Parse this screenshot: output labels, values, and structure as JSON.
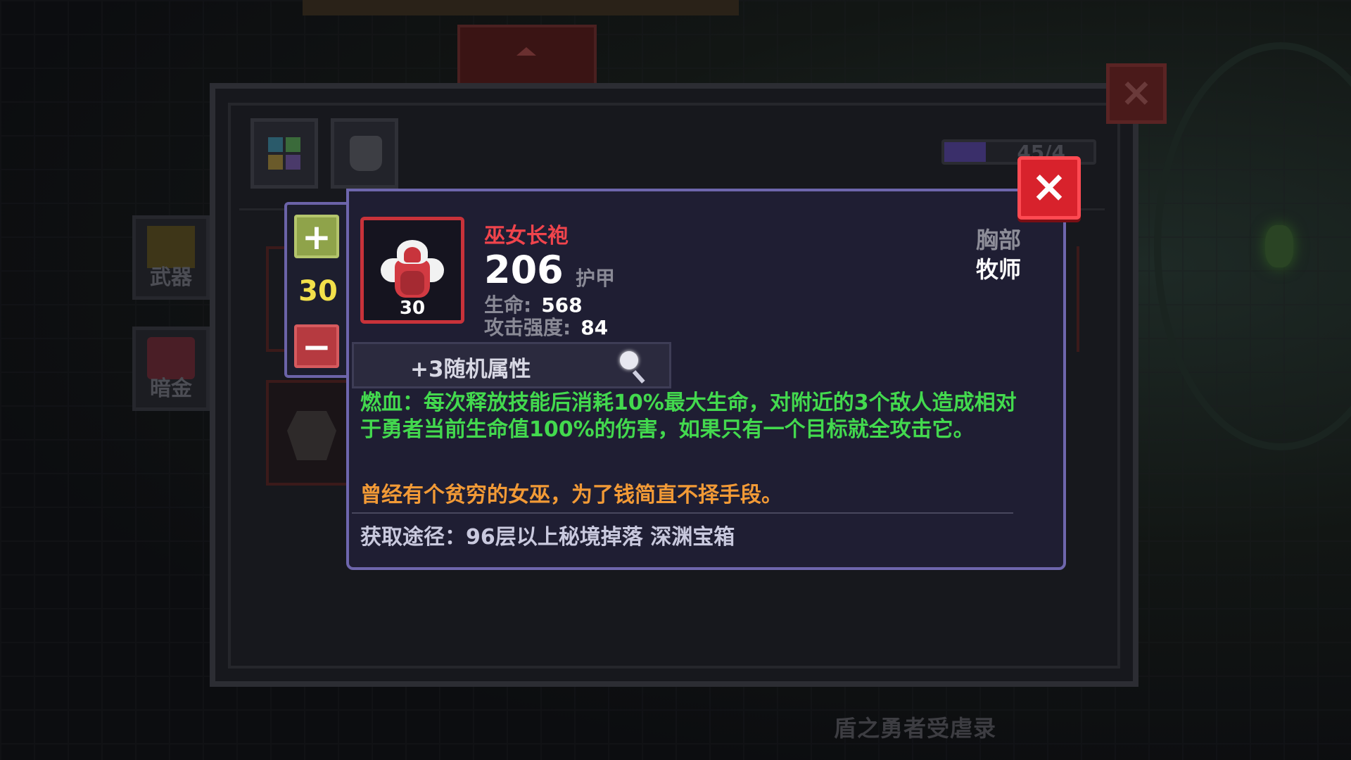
{
  "background": {
    "game_title": "盾之勇者受虐录"
  },
  "inventory": {
    "close_icon": "×",
    "xp_progress": "45/4",
    "xp_fill_fraction": 0.28,
    "categories": [
      {
        "label": "武器",
        "icon": "sword-icon"
      },
      {
        "label": "暗金",
        "icon": "chest-icon"
      }
    ],
    "tabs": [
      {
        "name": "grid-tab",
        "icon": "grid-icon"
      },
      {
        "name": "armor-tab",
        "icon": "armor-icon"
      }
    ]
  },
  "stepper": {
    "plus": "+",
    "minus": "−",
    "level": "30"
  },
  "item": {
    "name": "巫女长袍",
    "level": "30",
    "armor_value": "206",
    "armor_label": "护甲",
    "stats": [
      {
        "label": "生命:",
        "value": "568"
      },
      {
        "label": "攻击强度:",
        "value": "84"
      }
    ],
    "slot": "胸部",
    "class": "牧师",
    "random_attributes": "+3随机属性",
    "effect": "燃血：每次释放技能后消耗10%最大生命，对附近的3个敌人造成相对于勇者当前生命值100%的伤害，如果只有一个目标就全攻击它。",
    "flavor": "曾经有个贫穷的女巫，为了钱简直不择手段。",
    "source": "获取途径：96层以上秘境掉落 深渊宝箱",
    "close_icon": "×"
  },
  "colors": {
    "item_name": "#f0444c",
    "effect": "#43d94e",
    "flavor": "#f29a36",
    "level": "#f2e04a",
    "card_border": "#6e66ad",
    "close_button": "#d8222c"
  }
}
